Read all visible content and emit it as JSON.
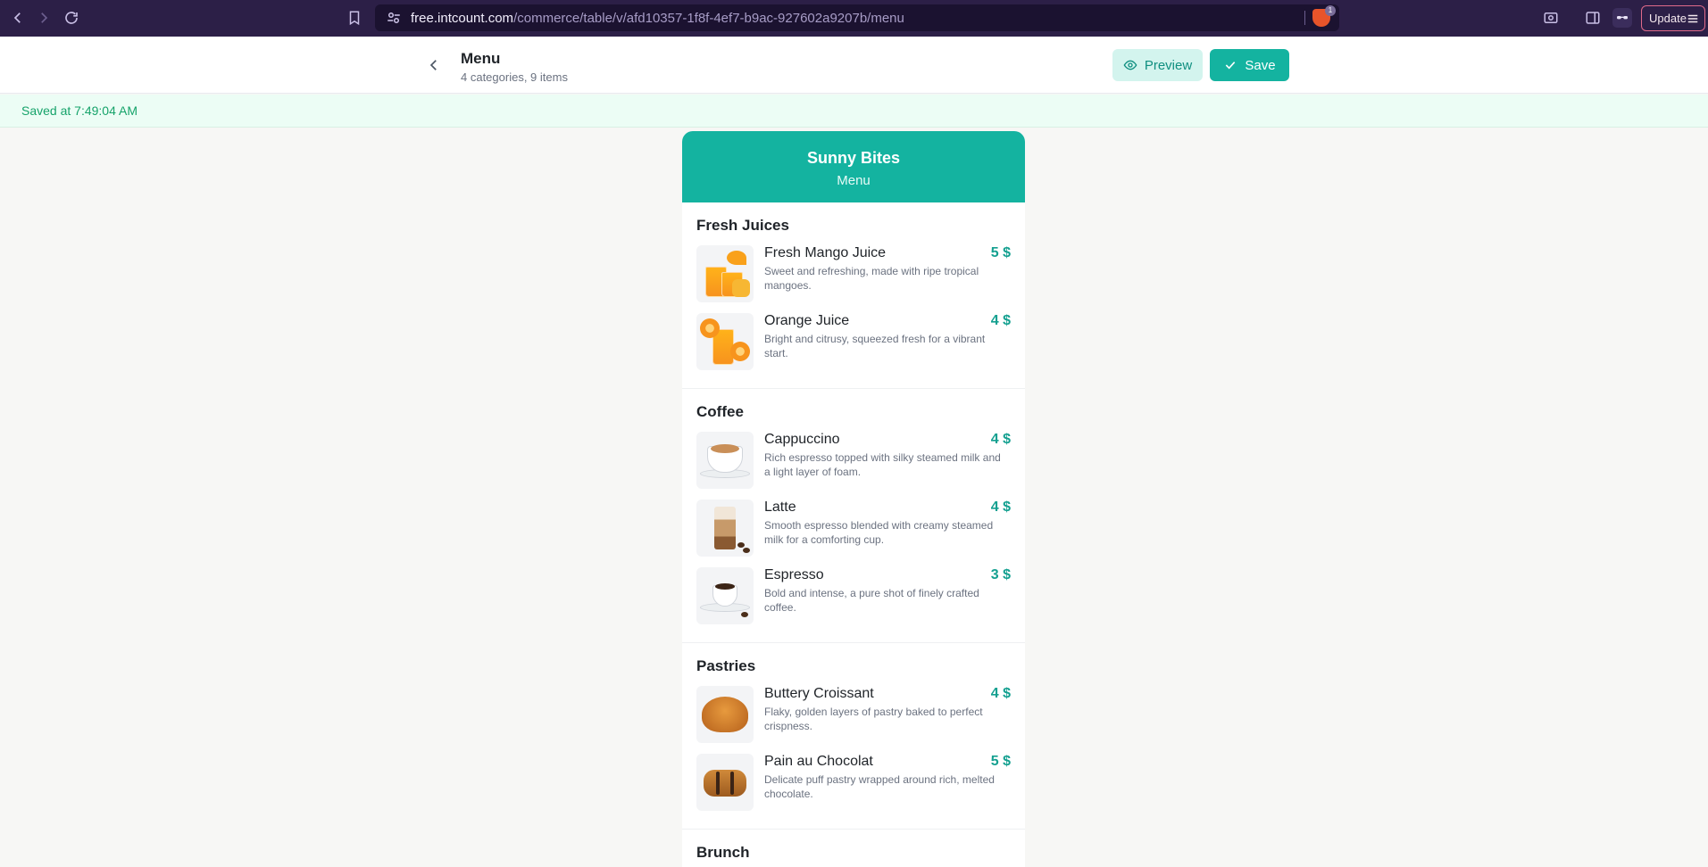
{
  "browser": {
    "url_host": "free.intcount.com",
    "url_path": "/commerce/table/v/afd10357-1f8f-4ef7-b9ac-927602a9207b/menu",
    "shield_count": "1",
    "update_label": "Update"
  },
  "header": {
    "title": "Menu",
    "subtitle": "4 categories, 9 items",
    "preview_label": "Preview",
    "save_label": "Save"
  },
  "status": {
    "saved_text": "Saved at 7:49:04 AM"
  },
  "menu": {
    "restaurant_name": "Sunny Bites",
    "subtitle": "Menu",
    "categories": [
      {
        "title": "Fresh Juices",
        "items": [
          {
            "name": "Fresh Mango Juice",
            "price": "5 $",
            "description": "Sweet and refreshing, made with ripe tropical mangoes."
          },
          {
            "name": "Orange Juice",
            "price": "4 $",
            "description": "Bright and citrusy, squeezed fresh for a vibrant start."
          }
        ]
      },
      {
        "title": "Coffee",
        "items": [
          {
            "name": "Cappuccino",
            "price": "4 $",
            "description": "Rich espresso topped with silky steamed milk and a light layer of foam."
          },
          {
            "name": "Latte",
            "price": "4 $",
            "description": "Smooth espresso blended with creamy steamed milk for a comforting cup."
          },
          {
            "name": "Espresso",
            "price": "3 $",
            "description": "Bold and intense, a pure shot of finely crafted coffee."
          }
        ]
      },
      {
        "title": "Pastries",
        "items": [
          {
            "name": "Buttery Croissant",
            "price": "4 $",
            "description": "Flaky, golden layers of pastry baked to perfect crispness."
          },
          {
            "name": "Pain au Chocolat",
            "price": "5 $",
            "description": "Delicate puff pastry wrapped around rich, melted chocolate."
          }
        ]
      },
      {
        "title": "Brunch",
        "items": []
      }
    ]
  },
  "colors": {
    "accent": "#14b3a0",
    "browser_bg": "#2c1f47",
    "saved_text": "#16a36a"
  }
}
